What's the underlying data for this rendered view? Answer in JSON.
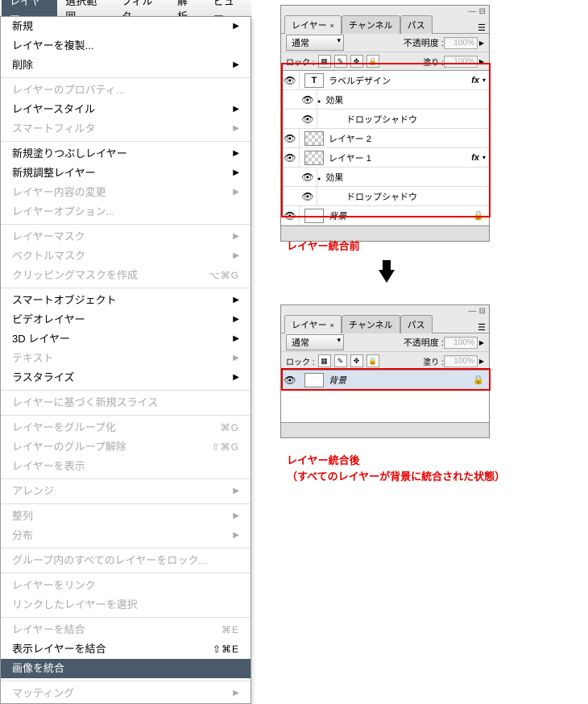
{
  "menubar": {
    "layer": "レイヤー",
    "select": "選択範囲",
    "filter": "フィルタ",
    "analysis": "解析",
    "view": "ビュー"
  },
  "menu": {
    "new": "新規",
    "dup": "レイヤーを複製...",
    "del": "削除",
    "props": "レイヤーのプロパティ...",
    "style": "レイヤースタイル",
    "smartf": "スマートフィルタ",
    "newfill": "新規塗りつぶしレイヤー",
    "newadj": "新規調整レイヤー",
    "content": "レイヤー内容の変更",
    "options": "レイヤーオプション...",
    "lmask": "レイヤーマスク",
    "vmask": "ベクトルマスク",
    "clip": "クリッピングマスクを作成",
    "clip_sc": "⌥⌘G",
    "smartobj": "スマートオブジェクト",
    "video": "ビデオレイヤー",
    "threeD": "3D レイヤー",
    "text": "テキスト",
    "raster": "ラスタライズ",
    "slice": "レイヤーに基づく新規スライス",
    "group": "レイヤーをグループ化",
    "group_sc": "⌘G",
    "ungroup": "レイヤーのグループ解除",
    "ungroup_sc": "⇧⌘G",
    "hide": "レイヤーを表示",
    "arrange": "アレンジ",
    "align": "整列",
    "dist": "分布",
    "lockall": "グループ内のすべてのレイヤーをロック...",
    "link": "レイヤーをリンク",
    "sellinked": "リンクしたレイヤーを選択",
    "merge": "レイヤーを結合",
    "merge_sc": "⌘E",
    "mergevis": "表示レイヤーを結合",
    "mergevis_sc": "⇧⌘E",
    "flatten": "画像を統合",
    "matting": "マッティング"
  },
  "panel": {
    "tab_layer": "レイヤー",
    "tab_channel": "チャンネル",
    "tab_path": "パス",
    "blend": "通常",
    "opacity_label": "不透明度 :",
    "opacity_val": "100%",
    "lock_label": "ロック :",
    "fill_label": "塗り :",
    "fill_val": "100%"
  },
  "layers1": {
    "l0": "ラベルデザイン",
    "fx": "fx",
    "effect": "効果",
    "drop": "ドロップシャドウ",
    "l1": "レイヤー 2",
    "l2": "レイヤー 1",
    "bg": "背景"
  },
  "layers2": {
    "bg": "背景"
  },
  "captions": {
    "before": "レイヤー統合前",
    "after1": "レイヤー統合後",
    "after2": "（すべてのレイヤーが背景に統合された状態）"
  }
}
